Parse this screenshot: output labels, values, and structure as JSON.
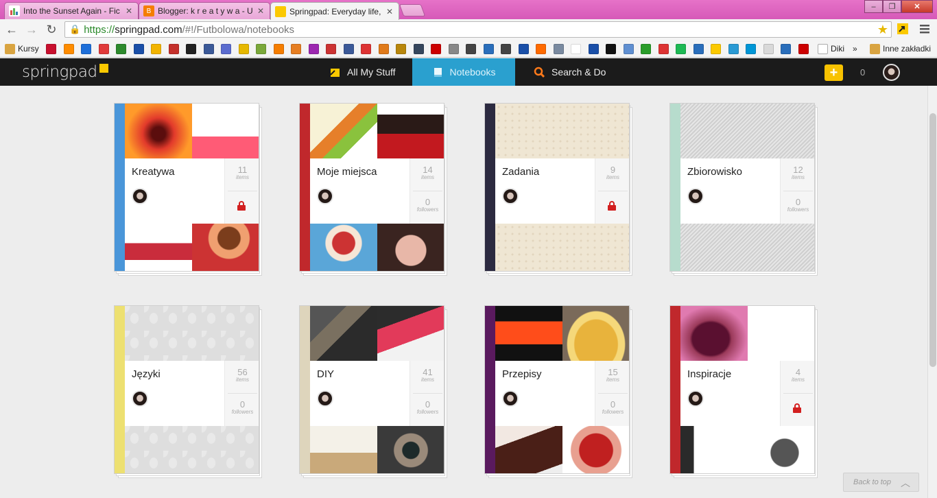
{
  "browser": {
    "tabs": [
      {
        "title": "Into the Sunset Again - Fic",
        "favicon_color": "#d9534f"
      },
      {
        "title": "Blogger: k r e a t y w a - Ul",
        "favicon_color": "#f57d00"
      },
      {
        "title": "Springpad: Everyday life, o",
        "favicon_color": "#fbc900"
      }
    ],
    "url": {
      "scheme": "https://",
      "host": "springpad.com",
      "path": "/#!/Futbolowa/notebooks"
    },
    "bookmarks": [
      {
        "label": "Kursy",
        "icon": "folder-icon",
        "color": "#d9a441"
      },
      {
        "label": "Diki",
        "icon": "page-icon",
        "color": "#ffffff"
      },
      {
        "label": "Inne zakładki",
        "icon": "folder-icon",
        "color": "#d9a441"
      }
    ],
    "bookmark_overflow": "»"
  },
  "springpad": {
    "logo": "springpad",
    "nav": {
      "all_my_stuff": "All My Stuff",
      "notebooks": "Notebooks",
      "search_do": "Search & Do"
    },
    "add_label": "+",
    "notification_count": "0",
    "accent": "#2aa0cf",
    "brand": "#fbc900"
  },
  "notebooks": [
    {
      "name": "Kreatywa",
      "items": "11",
      "items_label": "items",
      "followers": null,
      "followers_label": "",
      "locked": true,
      "spine": "#4a96d9"
    },
    {
      "name": "Moje miejsca",
      "items": "14",
      "items_label": "items",
      "followers": "0",
      "followers_label": "followers",
      "locked": false,
      "spine": "#c0282c"
    },
    {
      "name": "Zadania",
      "items": "9",
      "items_label": "items",
      "followers": null,
      "followers_label": "",
      "locked": true,
      "spine": "#2c2a40"
    },
    {
      "name": "Zbiorowisko",
      "items": "12",
      "items_label": "items",
      "followers": "0",
      "followers_label": "followers",
      "locked": false,
      "spine": "#b7dccd"
    },
    {
      "name": "Języki",
      "items": "56",
      "items_label": "items",
      "followers": "0",
      "followers_label": "followers",
      "locked": false,
      "spine": "#ede071"
    },
    {
      "name": "DIY",
      "items": "41",
      "items_label": "items",
      "followers": "0",
      "followers_label": "followers",
      "locked": false,
      "spine": "#ded5bc"
    },
    {
      "name": "Przepisy",
      "items": "15",
      "items_label": "items",
      "followers": "0",
      "followers_label": "followers",
      "locked": false,
      "spine": "#5a1a5e"
    },
    {
      "name": "Inspiracje",
      "items": "4",
      "items_label": "items",
      "followers": null,
      "followers_label": "",
      "locked": true,
      "spine": "#c0282c"
    }
  ],
  "back_to_top": "Back to top"
}
